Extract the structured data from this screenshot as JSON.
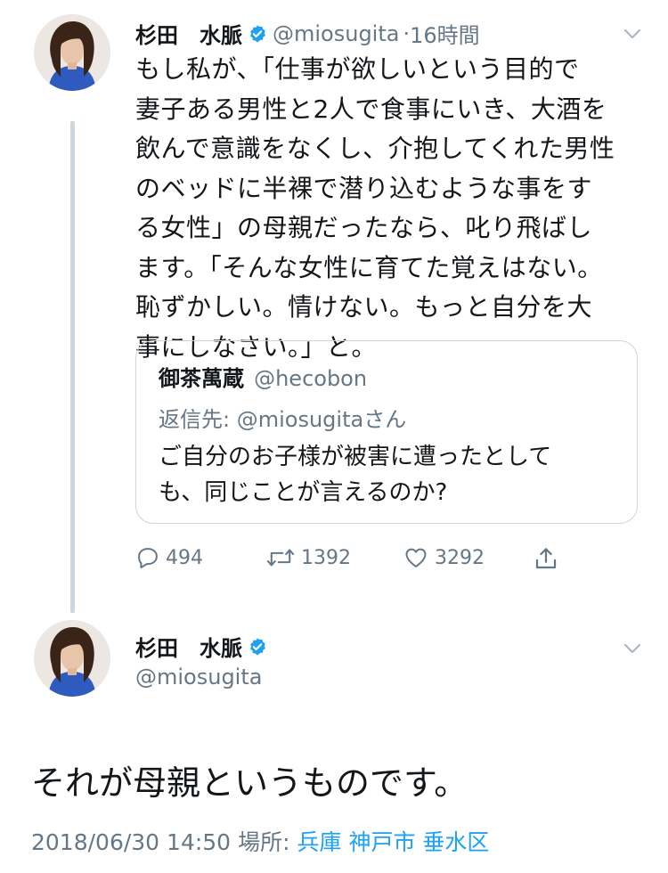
{
  "tweet1": {
    "display_name": "杉田　水脈",
    "handle": "@miosugita",
    "dot": "·",
    "time": "16時間",
    "text": "もし私が、「仕事が欲しいという目的で\n妻子ある男性と2人で食事にいき、大酒を\n飲んで意識をなくし、介抱してくれた男性\nのベッドに半裸で潜り込むような事をす\nる女性」の母親だったなら、叱り飛ばし\nます。「そんな女性に育てた覚えはない。\n恥ずかしい。情けない。もっと自分を大\n事にしなさい。」と。",
    "quote": {
      "display_name": "御茶萬蔵",
      "handle": "@hecobon",
      "reply_prefix": "返信先:",
      "reply_handle": "@miosugita",
      "reply_suffix": "さん",
      "text": "ご自分のお子様が被害に遭ったとして\nも、同じことが言えるのか?"
    },
    "actions": {
      "reply_count": "494",
      "retweet_count": "1392",
      "like_count": "3292"
    }
  },
  "tweet2": {
    "display_name": "杉田　水脈",
    "handle": "@miosugita",
    "text": "それが母親というものです。",
    "timestamp": "2018/06/30 14:50",
    "location_label": "場所:",
    "location": "兵庫 神戸市 垂水区"
  },
  "icons": {
    "verified": "verified-badge-icon",
    "more": "chevron-down-icon",
    "reply": "reply-icon",
    "retweet": "retweet-icon",
    "like": "heart-icon",
    "share": "share-icon"
  },
  "colors": {
    "verified_blue": "#1da1f2",
    "secondary_text": "#657786",
    "thread_line": "#ccd6dd",
    "link": "#1da1f2"
  }
}
